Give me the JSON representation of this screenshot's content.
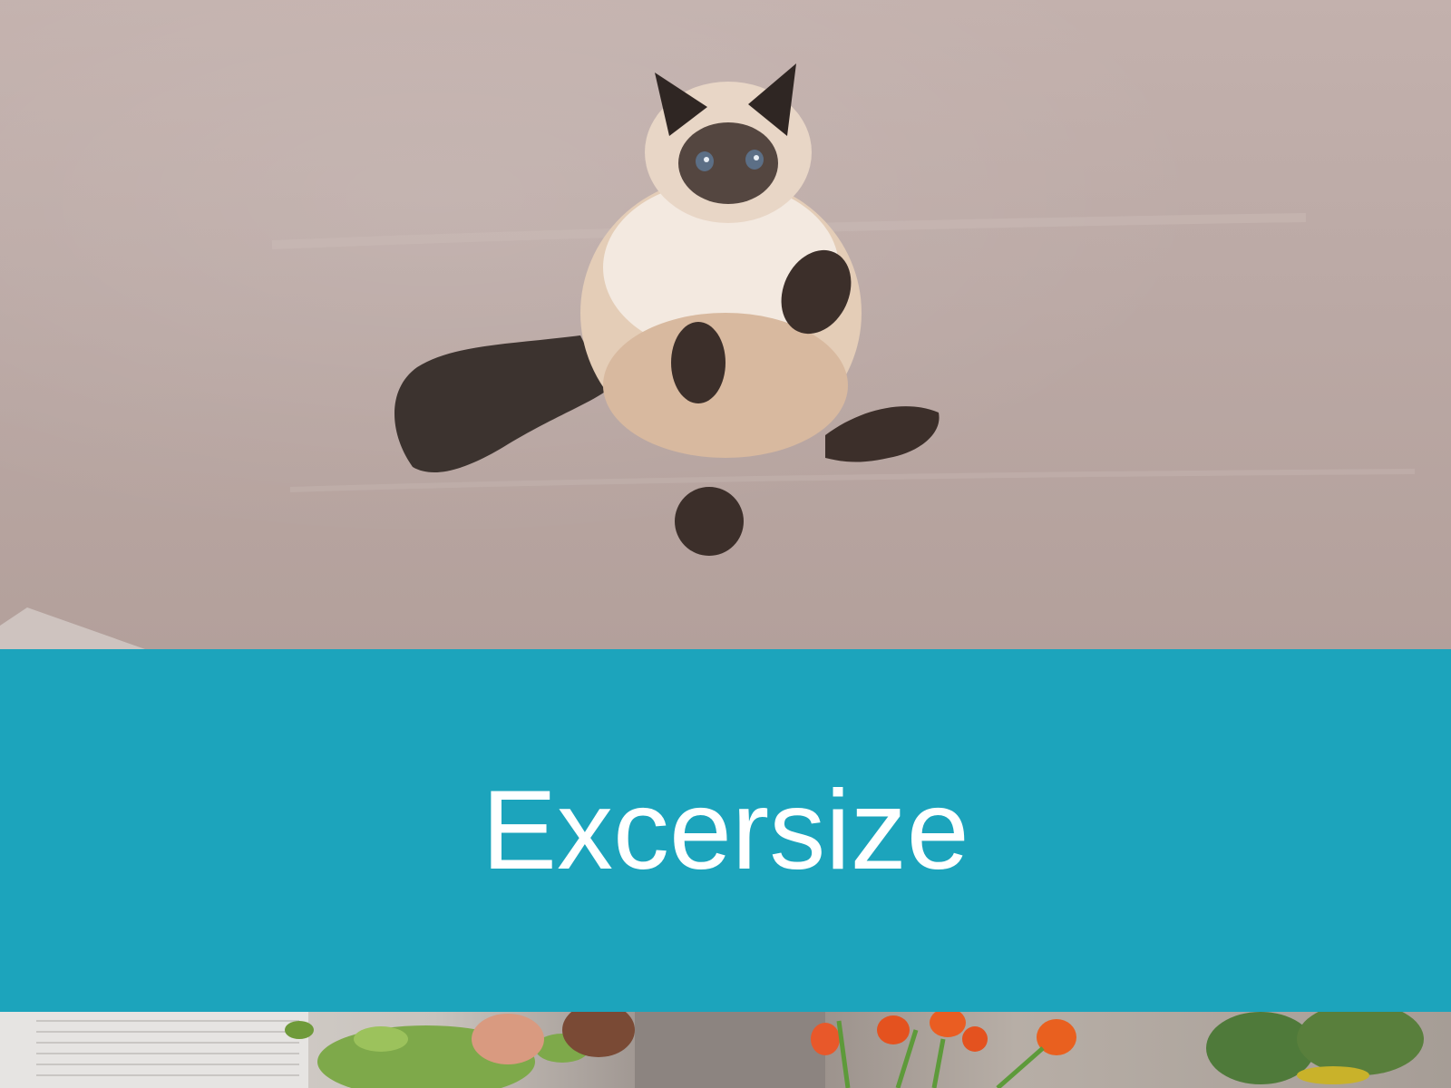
{
  "slide": {
    "title": "Excersize"
  },
  "colors": {
    "banner": "#1ca4bc",
    "title_text": "#ffffff",
    "wall": "#bba9a5"
  },
  "images": {
    "top": "photo-of-fluffy-siamese-cat-jumping",
    "bottom": "photo-of-plants-and-orange-tulips"
  }
}
